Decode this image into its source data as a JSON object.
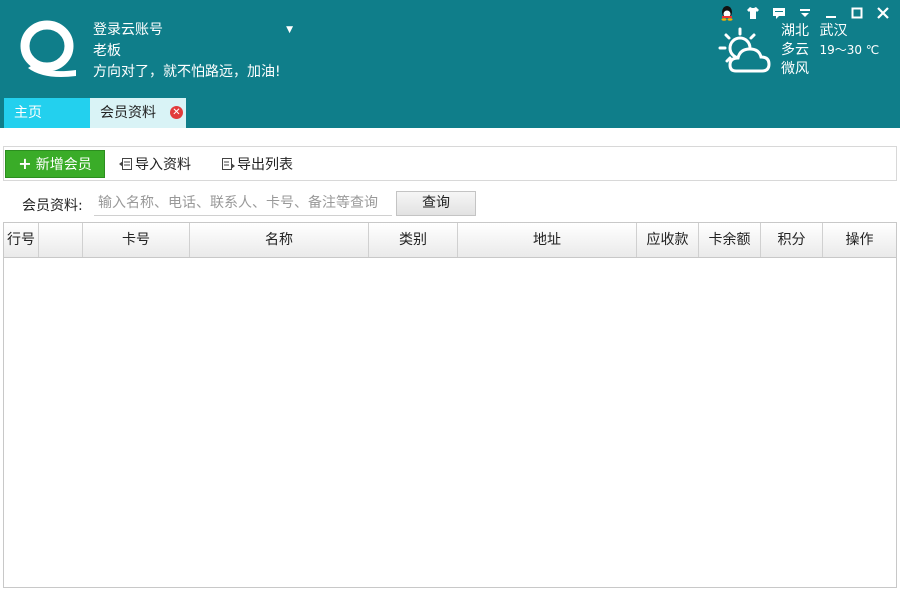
{
  "account": {
    "login_label": "登录云账号",
    "user_name": "老板",
    "slogan": "方向对了，就不怕路远，加油!"
  },
  "weather": {
    "region": "湖北",
    "city": "武汉",
    "condition": "多云",
    "temperature": "19～30 ℃",
    "wind": "微风"
  },
  "tabs": [
    {
      "label": "主页"
    },
    {
      "label": "会员资料"
    }
  ],
  "toolbar": {
    "add_label": "新增会员",
    "import_label": "导入资料",
    "export_label": "导出列表"
  },
  "search": {
    "label": "会员资料:",
    "placeholder": "输入名称、电话、联系人、卡号、备注等查询",
    "button_label": "查询"
  },
  "table": {
    "columns": [
      "行号",
      "",
      "卡号",
      "名称",
      "类别",
      "地址",
      "应收款",
      "卡余额",
      "积分",
      "操作"
    ],
    "rows": []
  },
  "colors": {
    "header_bg": "#0f7e8a",
    "active_tab": "#23d0ee",
    "add_button": "#3aac28"
  }
}
